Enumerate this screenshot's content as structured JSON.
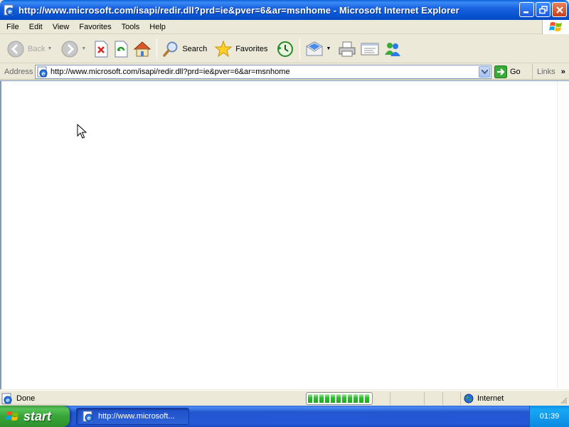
{
  "window": {
    "title": "http://www.microsoft.com/isapi/redir.dll?prd=ie&pver=6&ar=msnhome - Microsoft Internet Explorer"
  },
  "menu": {
    "items": [
      "File",
      "Edit",
      "View",
      "Favorites",
      "Tools",
      "Help"
    ]
  },
  "toolbar": {
    "back_label": "Back",
    "back_enabled": false,
    "search_label": "Search",
    "favorites_label": "Favorites",
    "icons": [
      "back-icon",
      "forward-icon",
      "stop-icon",
      "refresh-icon",
      "home-icon",
      "search-icon",
      "favorites-icon",
      "history-icon",
      "mail-icon",
      "print-icon",
      "edit-icon",
      "messenger-icon"
    ]
  },
  "address": {
    "label": "Address",
    "url": "http://www.microsoft.com/isapi/redir.dll?prd=ie&pver=6&ar=msnhome",
    "go_label": "Go",
    "links_label": "Links",
    "links_chevron": "»"
  },
  "status": {
    "text": "Done",
    "progress_fraction": 1.0,
    "zone": "Internet"
  },
  "taskbar": {
    "start_label": "start",
    "task_label": "http://www.microsoft...",
    "clock": "01:39"
  },
  "colors": {
    "titlebar": "#0553d0",
    "start_button": "#39a539",
    "taskbar": "#2458d8",
    "tray": "#17a7f4"
  }
}
